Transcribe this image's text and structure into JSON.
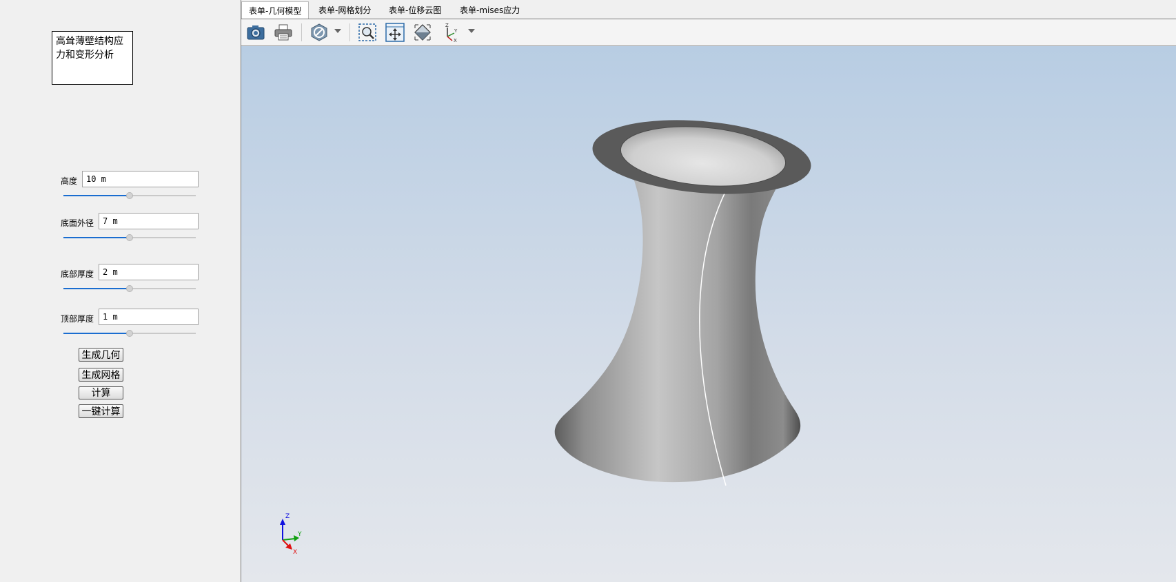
{
  "app_title": "高耸薄壁结构应力和变形分析",
  "params": [
    {
      "label": "高度",
      "value": "10 m",
      "slider_value": 0.5
    },
    {
      "label": "底面外径",
      "value": "7 m",
      "slider_value": 0.5
    },
    {
      "label": "底部厚度",
      "value": "2 m",
      "slider_value": 0.5
    },
    {
      "label": "顶部厚度",
      "value": "1 m",
      "slider_value": 0.5
    }
  ],
  "buttons": {
    "generate_geometry": "生成几何",
    "generate_mesh": "生成网格",
    "compute": "计算",
    "one_click_compute": "一键计算"
  },
  "tabs": [
    {
      "label": "表单-几何模型",
      "active": true
    },
    {
      "label": "表单-网格划分",
      "active": false
    },
    {
      "label": "表单-位移云图",
      "active": false
    },
    {
      "label": "表单-mises应力",
      "active": false
    }
  ],
  "toolbar": {
    "icons": [
      "camera-icon",
      "printer-icon",
      "display-mode-icon",
      "zoom-window-icon",
      "fit-all-icon",
      "view-cube-icon",
      "view-orientation-icon"
    ]
  },
  "triad": {
    "x_label": "X",
    "y_label": "Y",
    "z_label": "Z"
  },
  "colors": {
    "accent": "#1a6dd0",
    "viewport_top": "#b8cde3",
    "viewport_bottom": "#e4e7ec",
    "axis_x": "#e01010",
    "axis_y": "#10a010",
    "axis_z": "#1010e0"
  }
}
